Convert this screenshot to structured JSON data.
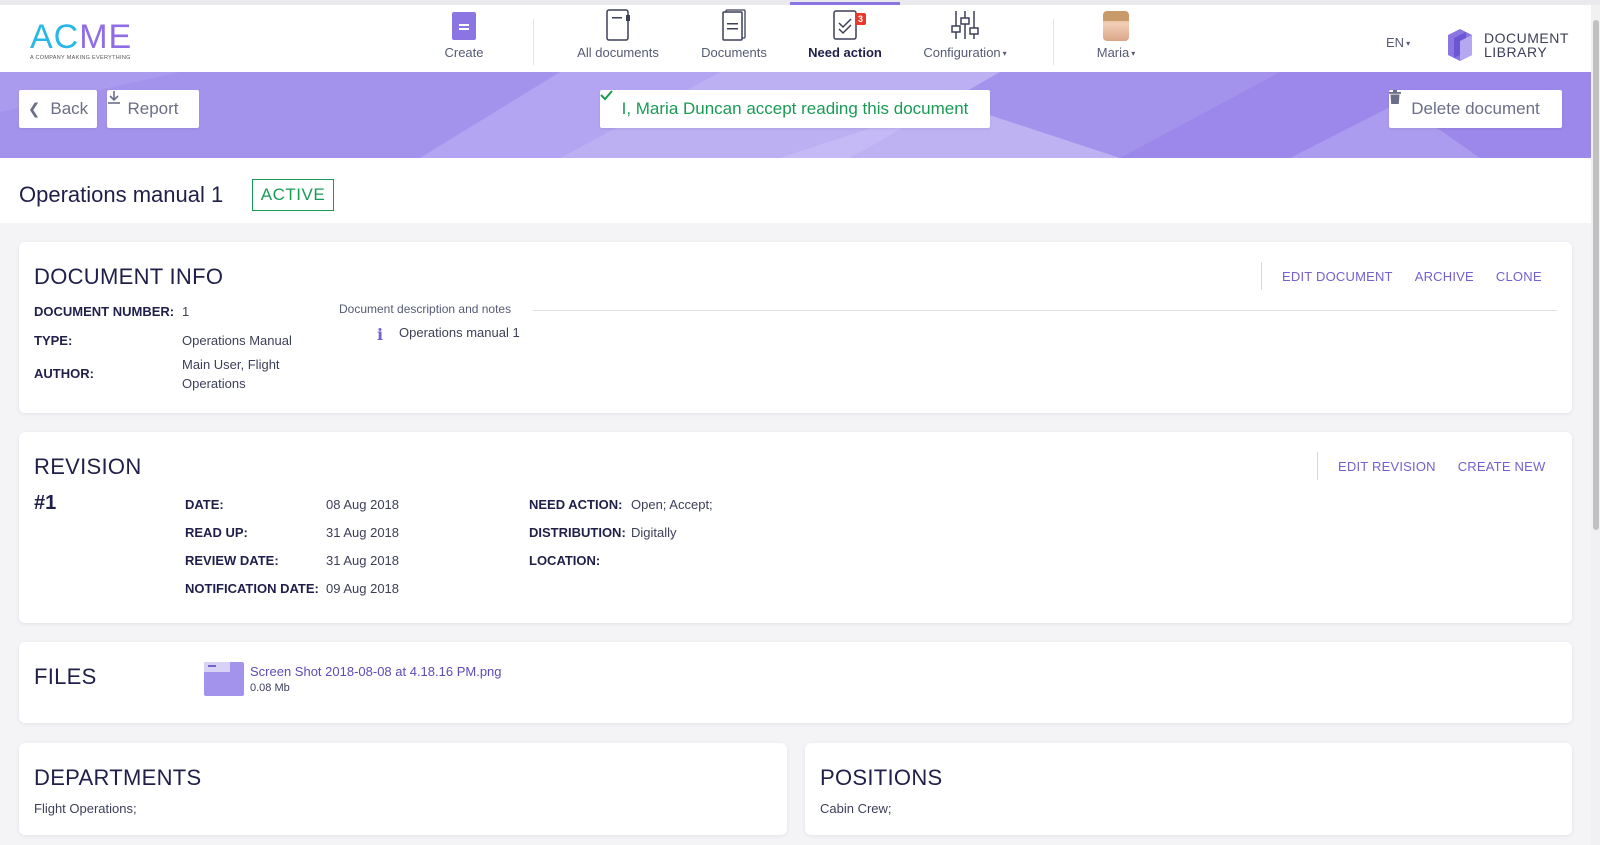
{
  "logo": {
    "name_a": "AC",
    "name_b": "ME",
    "tagline": "A COMPANY MAKING EVERYTHING"
  },
  "nav": {
    "create": "Create",
    "all_documents": "All documents",
    "documents": "Documents",
    "need_action": "Need action",
    "need_action_count": "3",
    "configuration": "Configuration",
    "user": "Maria",
    "language": "EN",
    "library_line1": "DOCUMENT",
    "library_line2": "LIBRARY",
    "caret": "▾"
  },
  "banner": {
    "back": "Back",
    "report": "Report",
    "accept": "I, Maria Duncan accept reading this document",
    "delete": "Delete document"
  },
  "document": {
    "title": "Operations manual 1",
    "status": "ACTIVE"
  },
  "doc_info": {
    "title": "DOCUMENT INFO",
    "actions": {
      "edit": "EDIT DOCUMENT",
      "archive": "ARCHIVE",
      "clone": "CLONE"
    },
    "number_label": "DOCUMENT NUMBER:",
    "number_value": "1",
    "type_label": "TYPE:",
    "type_value": "Operations Manual",
    "author_label": "AUTHOR:",
    "author_value_line1": "Main User, Flight",
    "author_value_line2": "Operations",
    "desc_heading": "Document description and notes",
    "desc_icon": "i",
    "desc_text": "Operations manual 1"
  },
  "revision": {
    "title": "REVISION",
    "number": "#1",
    "actions": {
      "edit": "EDIT REVISION",
      "create": "CREATE NEW"
    },
    "date_label": "DATE:",
    "date_value": "08 Aug 2018",
    "readup_label": "READ UP:",
    "readup_value": "31 Aug 2018",
    "review_label": "REVIEW DATE:",
    "review_value": "31 Aug 2018",
    "notif_label": "NOTIFICATION DATE:",
    "notif_value": "09 Aug 2018",
    "need_label": "NEED ACTION:",
    "need_value": "Open; Accept;",
    "dist_label": "DISTRIBUTION:",
    "dist_value": "Digitally",
    "loc_label": "LOCATION:",
    "loc_value": ""
  },
  "files": {
    "title": "FILES",
    "items": [
      {
        "name": "Screen Shot 2018-08-08 at 4.18.16 PM.png",
        "size": "0.08 Mb"
      }
    ]
  },
  "departments": {
    "title": "DEPARTMENTS",
    "value": "Flight Operations;"
  },
  "positions": {
    "title": "POSITIONS",
    "value": "Cabin Crew;"
  },
  "colors": {
    "accent": "#8a75e3",
    "banner": "#a493ec",
    "success": "#1a9a55",
    "badge": "#e8372c",
    "navy": "#1f1f4a"
  }
}
